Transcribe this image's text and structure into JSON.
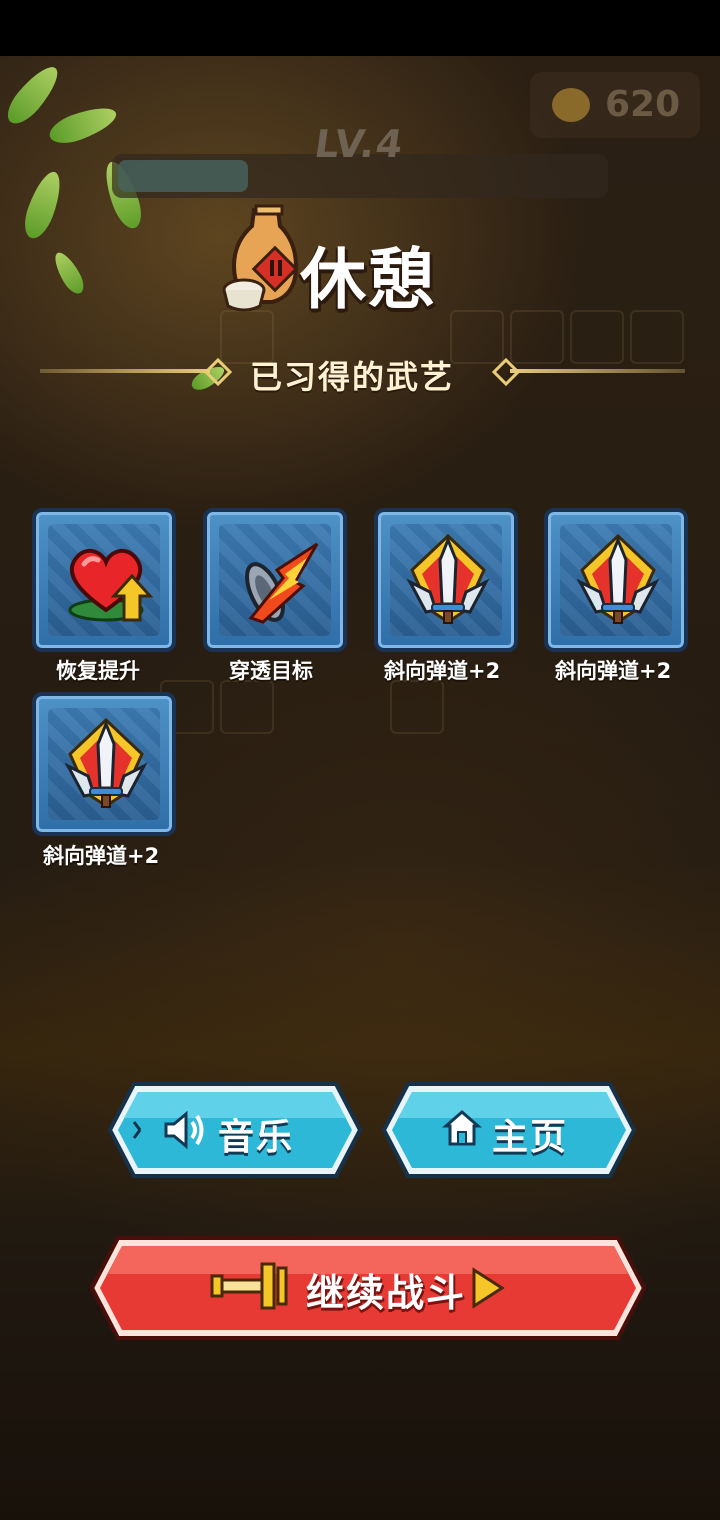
{
  "hud": {
    "coins": "620",
    "level": "LV.4"
  },
  "title": "休憩",
  "section_title": "已习得的武艺",
  "skills": [
    {
      "label": "恢复提升",
      "icon": "heal-up-icon"
    },
    {
      "label": "穿透目标",
      "icon": "pierce-icon"
    },
    {
      "label": "斜向弹道+2",
      "icon": "diagonal-blades-icon"
    },
    {
      "label": "斜向弹道+2",
      "icon": "diagonal-blades-icon"
    },
    {
      "label": "斜向弹道+2",
      "icon": "diagonal-blades-icon"
    }
  ],
  "buttons": {
    "music": "音乐",
    "home": "主页",
    "continue": "继续战斗"
  },
  "colors": {
    "blue_button": "#2db8d8",
    "red_button": "#e83a34",
    "gold_line": "#e8cc78"
  }
}
